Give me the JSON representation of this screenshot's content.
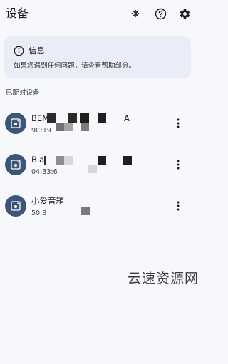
{
  "header": {
    "title": "设备",
    "icons": [
      "bluetooth-icon",
      "help-icon",
      "settings-icon"
    ]
  },
  "info_card": {
    "title": "信息",
    "body": "如果您遇到任何问题，请查看帮助部分。",
    "icon": "info-icon"
  },
  "paired_section": {
    "label": "已配对设备",
    "devices": [
      {
        "name": "BEM",
        "name_tail": "A",
        "address": "9C:19",
        "icon": "speaker-icon"
      },
      {
        "name": "Bla",
        "address": "04:33:6",
        "icon": "speaker-icon"
      },
      {
        "name": "小爱音箱",
        "address": "50:8",
        "icon": "speaker-icon"
      }
    ]
  },
  "watermark": {
    "text": "云速资源网"
  },
  "colors": {
    "background": "#f6f8fc",
    "card": "#e9edf7",
    "avatar": "#3d5576",
    "text": "#1b1c1f"
  }
}
